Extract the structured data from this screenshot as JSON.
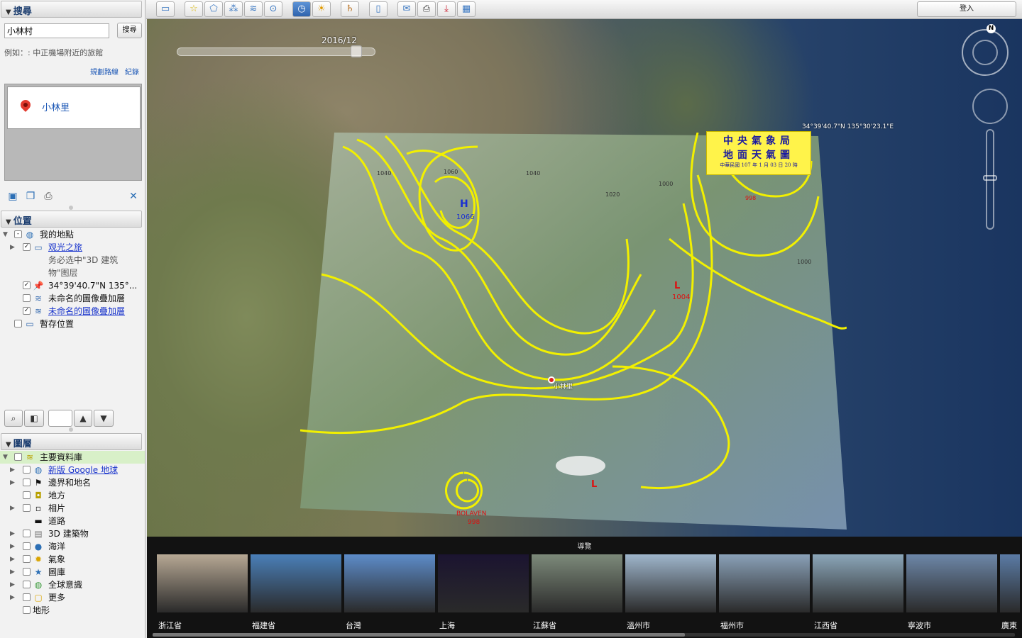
{
  "search": {
    "header": "搜尋",
    "query": "小林村",
    "button": "搜尋",
    "hint": "例如：: 中正機場附近的旅館",
    "route_link": "規劃路線",
    "history_link": "紀錄",
    "result": "小林里"
  },
  "places": {
    "header": "位置",
    "items": [
      {
        "label": "我的地點",
        "checked": "-",
        "icon": "globe-icon"
      },
      {
        "label": "观光之旅",
        "checked": "✓",
        "icon": "folder-icon",
        "link": true
      },
      {
        "label": "务必选中\"3D 建筑",
        "checked": "",
        "icon": ""
      },
      {
        "label": "物\"图层",
        "checked": "",
        "icon": ""
      },
      {
        "label": "34°39'40.7\"N 135°...",
        "checked": "✓",
        "icon": "pushpin-icon"
      },
      {
        "label": "未命名的圖像疊加層",
        "checked": "",
        "icon": "image-overlay-icon"
      },
      {
        "label": "未命名的圖像疊加層",
        "checked": "✓",
        "icon": "image-overlay-icon",
        "link": true
      },
      {
        "label": "暫存位置",
        "checked": "",
        "icon": "folder-icon"
      }
    ]
  },
  "layers": {
    "header": "圖層",
    "items": [
      {
        "label": "主要資料庫",
        "icon": "database-icon"
      },
      {
        "label": "新版 Google 地球",
        "icon": "globe-icon",
        "link": true
      },
      {
        "label": "邊界和地名",
        "icon": "flag-icon"
      },
      {
        "label": "地方",
        "icon": "place-icon"
      },
      {
        "label": "相片",
        "icon": "photo-icon"
      },
      {
        "label": "道路",
        "icon": "road-icon"
      },
      {
        "label": "3D 建築物",
        "icon": "building-icon"
      },
      {
        "label": "海洋",
        "icon": "ocean-icon"
      },
      {
        "label": "氣象",
        "icon": "weather-icon"
      },
      {
        "label": "圖庫",
        "icon": "gallery-icon"
      },
      {
        "label": "全球意識",
        "icon": "awareness-icon"
      },
      {
        "label": "更多",
        "icon": "more-icon"
      },
      {
        "label": "地形",
        "icon": ""
      }
    ]
  },
  "toolbar": {
    "login": "登入"
  },
  "map": {
    "time_label": "2016/12",
    "coordinates": "34°39'40.7\"N 135°30'23.1\"E",
    "compass_n": "N",
    "overlay_title_1": "中央氣象局",
    "overlay_title_2": "地面天氣圖",
    "overlay_title_3": "中華民國 107 年 1 月 03 日 20 時",
    "high_label": "H",
    "high_value": "1066",
    "low_value_1": "1004",
    "low_value_2": "998",
    "typhoon_name": "BOLAVEN",
    "typhoon_value": "998",
    "isobar_labels": [
      "1040",
      "1060",
      "1040",
      "1020",
      "1000",
      "1000"
    ],
    "place_marker": "小林里"
  },
  "tour": {
    "title": "導覽",
    "items": [
      {
        "label": "浙江省",
        "color": "#b7a894"
      },
      {
        "label": "福建省",
        "color": "#4a7fb8"
      },
      {
        "label": "台灣",
        "color": "#5d8cc9"
      },
      {
        "label": "上海",
        "color": "#1b1430"
      },
      {
        "label": "江蘇省",
        "color": "#7d8a7a"
      },
      {
        "label": "溫州市",
        "color": "#9fb6cc"
      },
      {
        "label": "福州市",
        "color": "#8aa1b8"
      },
      {
        "label": "江西省",
        "color": "#8ba6b9"
      },
      {
        "label": "寧波市",
        "color": "#6d87a8"
      },
      {
        "label": "廣東",
        "color": "#5b7ba5"
      }
    ]
  }
}
